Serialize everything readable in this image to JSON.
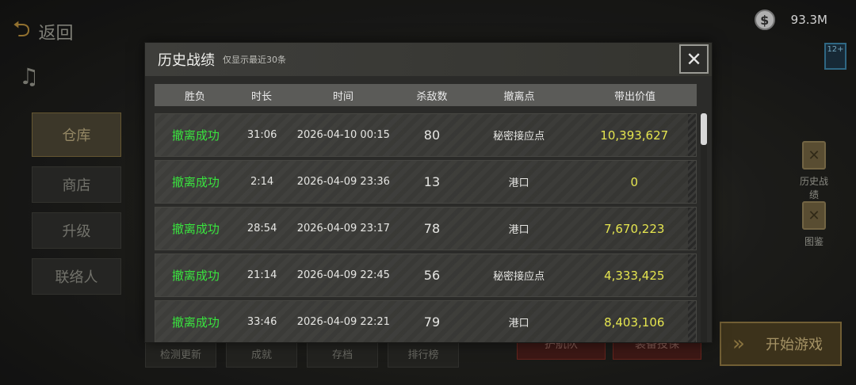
{
  "background": {
    "back_label": "返回",
    "side_menu": [
      "仓库",
      "商店",
      "升级",
      "联络人"
    ],
    "currency": {
      "value": "93.3M"
    },
    "age_badge": "12+",
    "right_entries": [
      "历史战绩",
      "图鉴"
    ],
    "bottom_buttons": [
      "检测更新",
      "成就",
      "存档",
      "排行榜"
    ],
    "red_buttons": [
      "护航队",
      "装备投保"
    ],
    "start_label": "开始游戏"
  },
  "modal": {
    "title": "历史战绩",
    "subtitle": "仅显示最近30条",
    "columns": [
      "胜负",
      "时长",
      "时间",
      "杀敌数",
      "撤离点",
      "带出价值"
    ],
    "rows": [
      {
        "result": "撤离成功",
        "duration": "31:06",
        "time": "2026-04-10 00:15",
        "kills": "80",
        "extract": "秘密接应点",
        "value": "10,393,627"
      },
      {
        "result": "撤离成功",
        "duration": "2:14",
        "time": "2026-04-09 23:36",
        "kills": "13",
        "extract": "港口",
        "value": "0"
      },
      {
        "result": "撤离成功",
        "duration": "28:54",
        "time": "2026-04-09 23:17",
        "kills": "78",
        "extract": "港口",
        "value": "7,670,223"
      },
      {
        "result": "撤离成功",
        "duration": "21:14",
        "time": "2026-04-09 22:45",
        "kills": "56",
        "extract": "秘密接应点",
        "value": "4,333,425"
      },
      {
        "result": "撤离成功",
        "duration": "33:46",
        "time": "2026-04-09 22:21",
        "kills": "79",
        "extract": "港口",
        "value": "8,403,106"
      }
    ]
  }
}
